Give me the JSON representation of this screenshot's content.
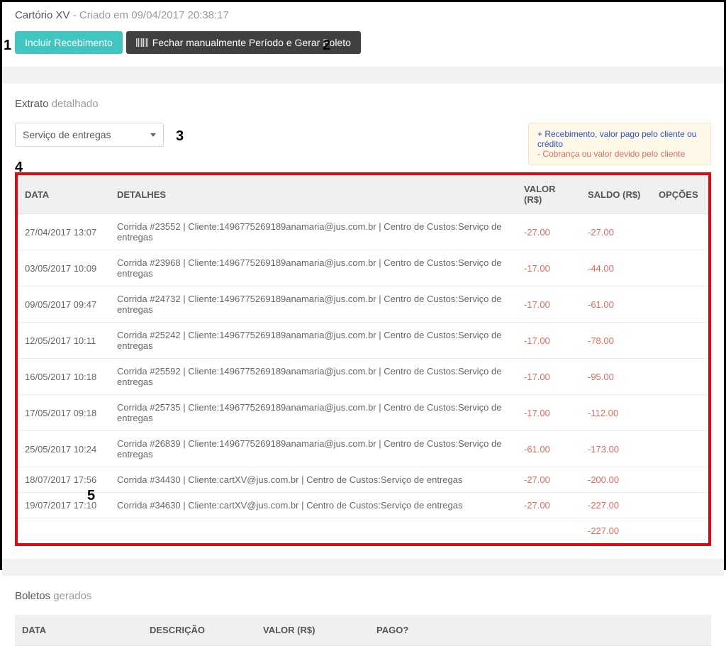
{
  "header": {
    "title": "Cartório XV",
    "created_prefix": " - Criado em ",
    "created_at": "09/04/2017 20:38:17"
  },
  "actions": {
    "incluir_label": "Incluir Recebimento",
    "fechar_label": "Fechar manualmente Período e Gerar Boleto"
  },
  "extrato": {
    "title_bold": "Extrato",
    "title_light": "detalhado",
    "filter_selected": "Serviço de entregas",
    "legend_pos": "+ Recebimento, valor pago pelo cliente ou crédito",
    "legend_neg": "- Cobrança ou valor devido pelo cliente",
    "columns": {
      "data": "DATA",
      "detalhes": "DETALHES",
      "valor": "VALOR (R$)",
      "saldo": "SALDO (R$)",
      "opcoes": "OPÇÕES"
    },
    "rows": [
      {
        "data": "27/04/2017 13:07",
        "detalhes": "Corrida #23552  |  Cliente:1496775269189anamaria@jus.com.br  |  Centro de Custos:Serviço de entregas",
        "valor": "-27.00",
        "saldo": "-27.00"
      },
      {
        "data": "03/05/2017 10:09",
        "detalhes": "Corrida #23968  |  Cliente:1496775269189anamaria@jus.com.br  |  Centro de Custos:Serviço de entregas",
        "valor": "-17.00",
        "saldo": "-44.00"
      },
      {
        "data": "09/05/2017 09:47",
        "detalhes": "Corrida #24732  |  Cliente:1496775269189anamaria@jus.com.br  |  Centro de Custos:Serviço de entregas",
        "valor": "-17.00",
        "saldo": "-61.00"
      },
      {
        "data": "12/05/2017 10:11",
        "detalhes": "Corrida #25242  |  Cliente:1496775269189anamaria@jus.com.br  |  Centro de Custos:Serviço de entregas",
        "valor": "-17.00",
        "saldo": "-78.00"
      },
      {
        "data": "16/05/2017 10:18",
        "detalhes": "Corrida #25592  |  Cliente:1496775269189anamaria@jus.com.br  |  Centro de Custos:Serviço de entregas",
        "valor": "-17.00",
        "saldo": "-95.00"
      },
      {
        "data": "17/05/2017 09:18",
        "detalhes": "Corrida #25735  |  Cliente:1496775269189anamaria@jus.com.br  |  Centro de Custos:Serviço de entregas",
        "valor": "-17.00",
        "saldo": "-112.00"
      },
      {
        "data": "25/05/2017 10:24",
        "detalhes": "Corrida #26839  |  Cliente:1496775269189anamaria@jus.com.br  |  Centro de Custos:Serviço de entregas",
        "valor": "-61.00",
        "saldo": "-173.00"
      },
      {
        "data": "18/07/2017 17:56",
        "detalhes": "Corrida #34430  |  Cliente:cartXV@jus.com.br  |  Centro de Custos:Serviço de entregas",
        "valor": "-27.00",
        "saldo": "-200.00"
      },
      {
        "data": "19/07/2017 17:10",
        "detalhes": "Corrida #34630  |  Cliente:cartXV@jus.com.br  |  Centro de Custos:Serviço de entregas",
        "valor": "-27.00",
        "saldo": "-227.00"
      }
    ],
    "footer_saldo": "-227.00"
  },
  "boletos": {
    "title_bold": "Boletos",
    "title_light": "gerados",
    "columns": {
      "data": "DATA",
      "descricao": "DESCRIÇÃO",
      "valor": "VALOR (R$)",
      "pago": "PAGO?"
    }
  },
  "annotations": {
    "a1": "1",
    "a2": "2",
    "a3": "3",
    "a4": "4",
    "a5": "5"
  }
}
